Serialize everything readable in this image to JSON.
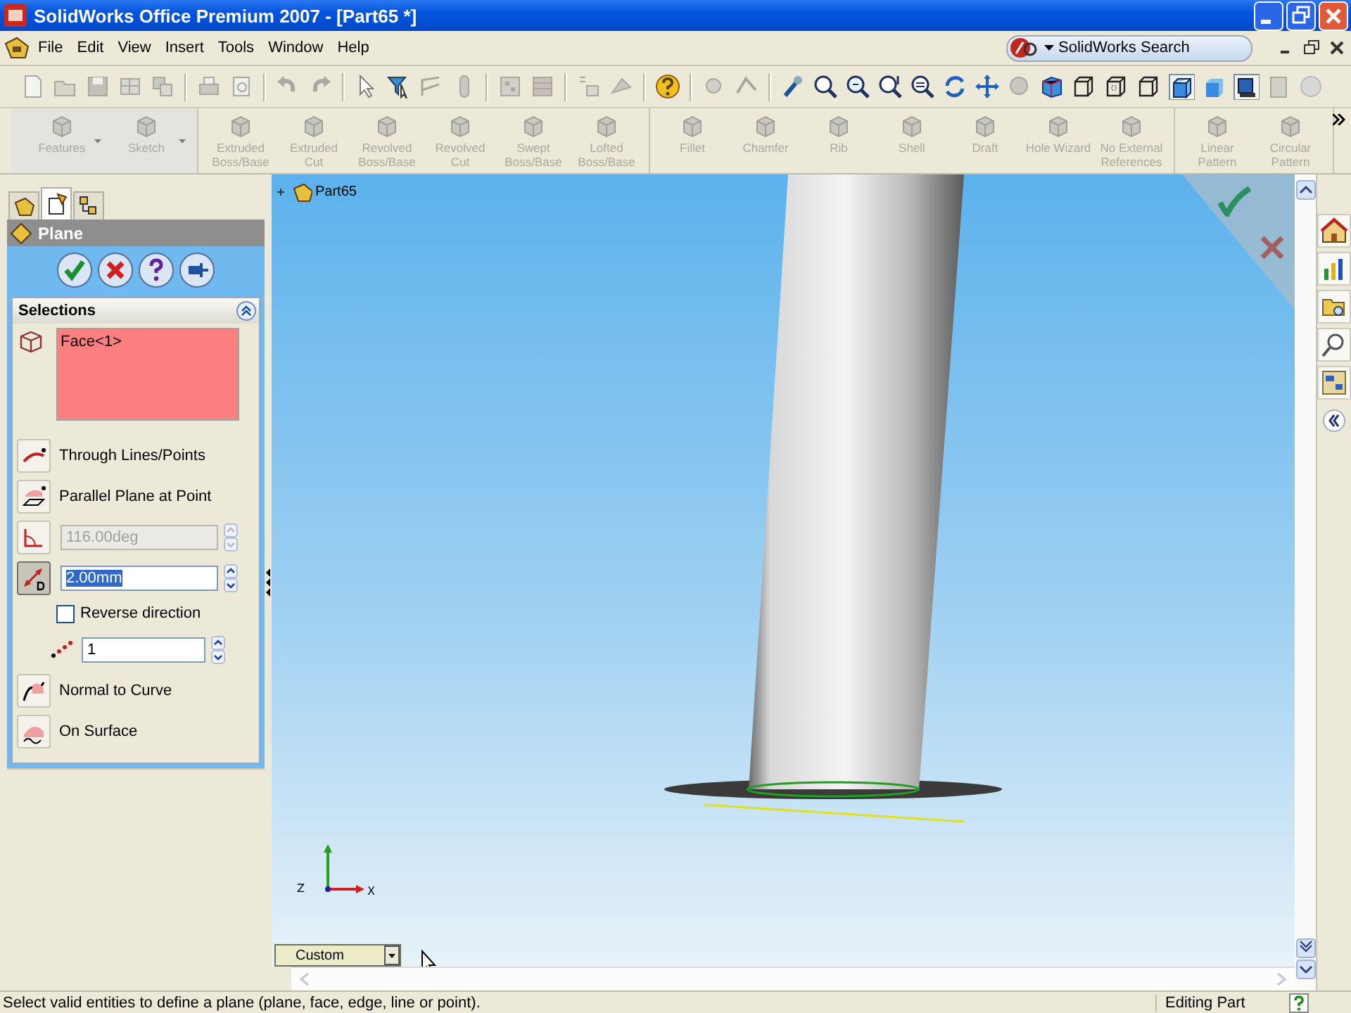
{
  "window": {
    "title": "SolidWorks Office Premium 2007 - [Part65 *]"
  },
  "menu": [
    "File",
    "Edit",
    "View",
    "Insert",
    "Tools",
    "Window",
    "Help"
  ],
  "search": {
    "placeholder": "SolidWorks Search"
  },
  "command_groups": [
    [
      {
        "label": "Features",
        "dropdown": true,
        "disabled": true
      },
      {
        "label": "Sketch",
        "dropdown": true,
        "disabled": true
      }
    ],
    [
      {
        "label": "Extruded Boss/Base",
        "dropdown": false,
        "disabled": true
      },
      {
        "label": "Extruded Cut",
        "dropdown": false,
        "disabled": true
      },
      {
        "label": "Revolved Boss/Base",
        "dropdown": false,
        "disabled": true
      },
      {
        "label": "Revolved Cut",
        "dropdown": false,
        "disabled": true
      },
      {
        "label": "Swept Boss/Base",
        "dropdown": false,
        "disabled": true
      },
      {
        "label": "Lofted Boss/Base",
        "dropdown": false,
        "disabled": true
      }
    ],
    [
      {
        "label": "Fillet",
        "dropdown": false,
        "disabled": true
      },
      {
        "label": "Chamfer",
        "dropdown": false,
        "disabled": true
      },
      {
        "label": "Rib",
        "dropdown": false,
        "disabled": true
      },
      {
        "label": "Shell",
        "dropdown": false,
        "disabled": true
      },
      {
        "label": "Draft",
        "dropdown": false,
        "disabled": true
      },
      {
        "label": "Hole Wizard",
        "dropdown": false,
        "disabled": true
      },
      {
        "label": "No External References",
        "dropdown": false,
        "disabled": true
      }
    ],
    [
      {
        "label": "Linear Pattern",
        "dropdown": false,
        "disabled": true
      },
      {
        "label": "Circular Pattern",
        "dropdown": false,
        "disabled": true
      }
    ]
  ],
  "property_manager": {
    "tabs": [
      {
        "kind": "tree",
        "selected": false
      },
      {
        "kind": "property",
        "selected": true
      },
      {
        "kind": "config",
        "selected": false
      }
    ],
    "title": "Plane",
    "selections": {
      "title": "Selections",
      "items": [
        "Face<1>"
      ]
    },
    "options": [
      {
        "kind": "toggle",
        "label": "Through Lines/Points"
      },
      {
        "kind": "toggle",
        "label": "Parallel Plane at Point"
      },
      {
        "kind": "spin",
        "value": "116.00deg",
        "disabled": true
      },
      {
        "kind": "spin",
        "value": "2.00mm",
        "disabled": false
      },
      {
        "kind": "checkbox",
        "label": "Reverse direction",
        "checked": false
      },
      {
        "kind": "spin",
        "value": "1",
        "disabled": false
      },
      {
        "kind": "toggle",
        "label": "Normal to Curve"
      },
      {
        "kind": "toggle",
        "label": "On Surface"
      }
    ]
  },
  "graphics": {
    "tree_root": "Part65",
    "triad": [
      "Z",
      "X"
    ],
    "view_dropdown": "Custom"
  },
  "status_bar": {
    "message": "Select valid entities to define a plane (plane, face, edge, line or point).",
    "mode": "Editing Part"
  }
}
